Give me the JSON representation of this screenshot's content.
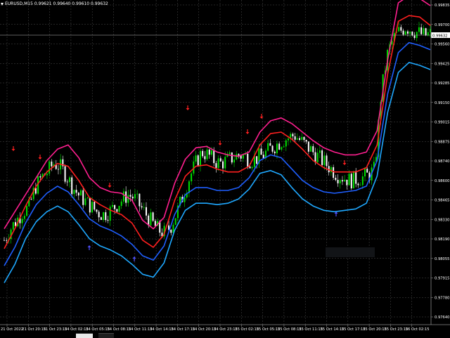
{
  "window": {
    "symbol_title": "EURUSD,M15",
    "ohlc": [
      "0.99621",
      "0.99640",
      "0.99610",
      "0.99632"
    ]
  },
  "price_axis": {
    "labels": [
      "0.99835",
      "0.99700",
      "0.99560",
      "0.99425",
      "0.99285",
      "0.99150",
      "0.99015",
      "0.98875",
      "0.98740",
      "0.98600",
      "0.98465",
      "0.98330",
      "0.98190",
      "0.98055",
      "0.97915",
      "0.97780",
      "0.97640"
    ],
    "current_price": "0.99632",
    "min": 0.9764,
    "max": 0.99835
  },
  "time_axis": {
    "labels": [
      "21 Oct 2022",
      "21 Oct 20:15",
      "21 Oct 23:15",
      "24 Oct 02:15",
      "24 Oct 05:15",
      "24 Oct 08:15",
      "24 Oct 11:15",
      "24 Oct 14:15",
      "24 Oct 17:15",
      "24 Oct 20:15",
      "24 Oct 23:15",
      "25 Oct 02:15",
      "25 Oct 05:15",
      "25 Oct 08:15",
      "25 Oct 11:15",
      "25 Oct 14:15",
      "25 Oct 17:15",
      "25 Oct 20:15",
      "25 Oct 23:15",
      "26 Oct 02:15"
    ]
  },
  "colors": {
    "background": "#000000",
    "grid": "#4a4a4a",
    "bull_candle": "#00e000",
    "bear_candle": "#ffffff",
    "upper_outer_band": "#ff1f8f",
    "upper_inner_band": "#ff1f1f",
    "lower_inner_band": "#1f5fff",
    "lower_outer_band": "#1fa8ff",
    "sell_arrow": "#ff2020",
    "buy_arrow": "#5050ff",
    "axis_text": "#ffffff"
  },
  "chart_data": {
    "type": "candlestick",
    "series": [
      {
        "name": "Close",
        "values": [
          0.9818,
          0.9826,
          0.9832,
          0.9838,
          0.9841,
          0.9855,
          0.9862,
          0.9866,
          0.9872,
          0.987,
          0.9864,
          0.9856,
          0.985,
          0.9846,
          0.9842,
          0.9838,
          0.9836,
          0.9838,
          0.9842,
          0.9846,
          0.985,
          0.9848,
          0.9842,
          0.9836,
          0.983,
          0.9825,
          0.9823,
          0.9828,
          0.9838,
          0.985,
          0.9862,
          0.9872,
          0.988,
          0.9878,
          0.9874,
          0.9872,
          0.9874,
          0.9876,
          0.9878,
          0.9877,
          0.9874,
          0.9876,
          0.9878,
          0.9882,
          0.9885,
          0.9888,
          0.989,
          0.9892,
          0.9888,
          0.9884,
          0.988,
          0.9876,
          0.9872,
          0.9868,
          0.9864,
          0.9862,
          0.986,
          0.9861,
          0.9862,
          0.9864,
          0.9868,
          0.992,
          0.9948,
          0.996,
          0.9965,
          0.9968,
          0.9966,
          0.9964,
          0.9962,
          0.9963
        ]
      }
    ],
    "upper_band_outer": [
      0.9826,
      0.9838,
      0.985,
      0.9862,
      0.9874,
      0.9882,
      0.9885,
      0.9876,
      0.9862,
      0.9855,
      0.9852,
      0.9851,
      0.9846,
      0.9832,
      0.9826,
      0.9834,
      0.9858,
      0.9875,
      0.9883,
      0.9884,
      0.988,
      0.9878,
      0.9877,
      0.988,
      0.9894,
      0.9902,
      0.9904,
      0.99,
      0.9894,
      0.9888,
      0.9883,
      0.988,
      0.9878,
      0.9878,
      0.988,
      0.9895,
      0.9945,
      0.9985,
      0.999,
      0.9988,
      0.9983
    ],
    "upper_band_inner": [
      0.9812,
      0.9826,
      0.9842,
      0.9856,
      0.9866,
      0.9872,
      0.987,
      0.986,
      0.9848,
      0.9843,
      0.9839,
      0.9836,
      0.983,
      0.9818,
      0.9813,
      0.9822,
      0.9846,
      0.9863,
      0.987,
      0.9871,
      0.9868,
      0.9866,
      0.9866,
      0.987,
      0.9885,
      0.9893,
      0.9894,
      0.9889,
      0.9882,
      0.9874,
      0.9869,
      0.9866,
      0.9866,
      0.9866,
      0.9869,
      0.9885,
      0.9935,
      0.9972,
      0.9976,
      0.9975,
      0.9969
    ],
    "lower_band_inner": [
      0.98,
      0.9813,
      0.983,
      0.9843,
      0.9851,
      0.9856,
      0.9852,
      0.9843,
      0.9833,
      0.9828,
      0.9825,
      0.9821,
      0.9815,
      0.9807,
      0.9804,
      0.9814,
      0.9836,
      0.985,
      0.9855,
      0.9855,
      0.9853,
      0.9853,
      0.9855,
      0.9862,
      0.9874,
      0.9878,
      0.9876,
      0.9868,
      0.986,
      0.9855,
      0.9852,
      0.9851,
      0.9852,
      0.9853,
      0.9856,
      0.9874,
      0.9921,
      0.995,
      0.9957,
      0.9955,
      0.9952
    ],
    "lower_band_outer": [
      0.9788,
      0.9801,
      0.9819,
      0.9831,
      0.9838,
      0.9842,
      0.9838,
      0.9829,
      0.9819,
      0.9814,
      0.9811,
      0.9807,
      0.9801,
      0.9794,
      0.9792,
      0.9802,
      0.9825,
      0.9839,
      0.9844,
      0.9844,
      0.9843,
      0.9844,
      0.9847,
      0.9854,
      0.9865,
      0.9867,
      0.9864,
      0.9855,
      0.9847,
      0.9842,
      0.9839,
      0.9838,
      0.9839,
      0.984,
      0.9844,
      0.9863,
      0.9908,
      0.9936,
      0.9943,
      0.9941,
      0.9938
    ],
    "sell_signals": [
      "21 Oct 2022 ~20:00",
      "21 Oct ~22:00",
      "24 Oct ~06:00",
      "24 Oct ~17:00",
      "24 Oct ~19:30",
      "25 Oct ~00:30",
      "25 Oct ~03:15",
      "25 Oct ~14:00"
    ],
    "buy_signals": [
      "24 Oct ~04:00",
      "24 Oct ~08:30",
      "25 Oct ~13:00"
    ],
    "ylim": [
      0.9764,
      0.99835
    ]
  }
}
